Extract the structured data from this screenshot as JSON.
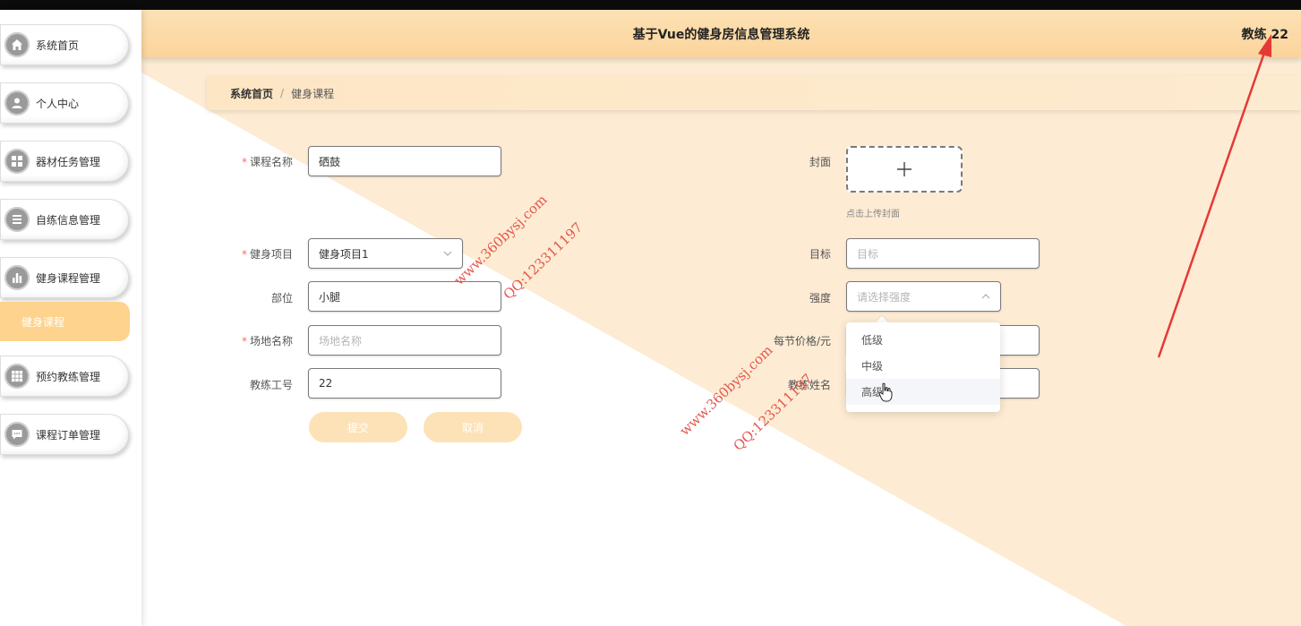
{
  "header": {
    "title": "基于Vue的健身房信息管理系统",
    "user": "教练 22"
  },
  "sidebar": {
    "items": [
      {
        "label": "系统首页",
        "icon": "home-icon"
      },
      {
        "label": "个人中心",
        "icon": "user-icon"
      },
      {
        "label": "器材任务管理",
        "icon": "grid-icon"
      },
      {
        "label": "自练信息管理",
        "icon": "list-icon"
      },
      {
        "label": "健身课程管理",
        "icon": "bar-chart-icon"
      },
      {
        "label": "预约教练管理",
        "icon": "table-icon"
      },
      {
        "label": "课程订单管理",
        "icon": "chat-icon"
      }
    ],
    "active_sub": "健身课程"
  },
  "breadcrumb": {
    "home": "系统首页",
    "separator": "/",
    "current": "健身课程"
  },
  "form": {
    "course_name": {
      "label": "课程名称",
      "value": "硒鼓"
    },
    "cover": {
      "label": "封面",
      "hint": "点击上传封面"
    },
    "fitness_item": {
      "label": "健身项目",
      "value": "健身项目1"
    },
    "goal": {
      "label": "目标",
      "placeholder": "目标"
    },
    "body_part": {
      "label": "部位",
      "value": "小腿"
    },
    "intensity": {
      "label": "强度",
      "placeholder": "请选择强度"
    },
    "venue": {
      "label": "场地名称",
      "placeholder": "场地名称"
    },
    "price": {
      "label": "每节价格/元"
    },
    "coach_id": {
      "label": "教练工号",
      "value": "22"
    },
    "coach_name": {
      "label": "教练姓名"
    },
    "submit_label": "提交",
    "cancel_label": "取消"
  },
  "intensity_options": [
    "低级",
    "中级",
    "高级"
  ],
  "watermarks": {
    "site": "www.360bysj.com",
    "qq": "QQ:123311197"
  },
  "colors": {
    "accent": "#fdd38e",
    "header": "#fbd49c",
    "required": "#f56c6c",
    "annotation_arrow": "#e53935"
  }
}
